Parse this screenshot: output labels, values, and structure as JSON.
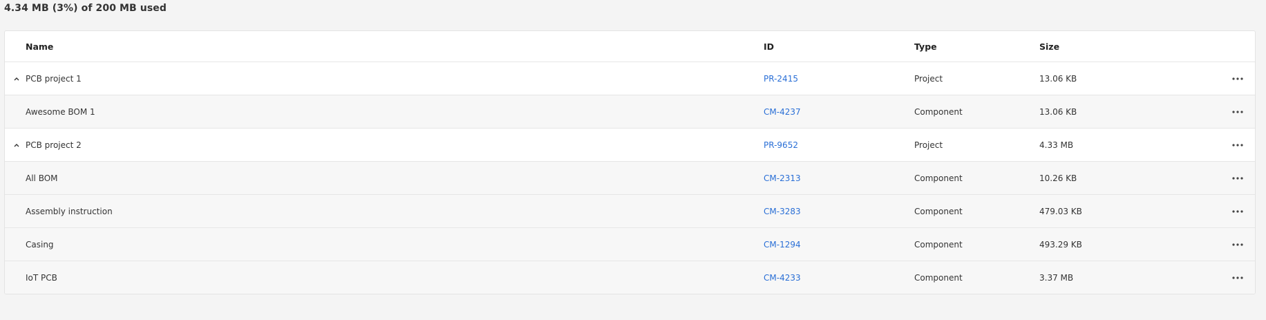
{
  "storage": {
    "usage_text": "4.34 MB (3%) of 200 MB used"
  },
  "table": {
    "columns": {
      "name": "Name",
      "id": "ID",
      "type": "Type",
      "size": "Size"
    },
    "rows": [
      {
        "kind": "parent",
        "name": "PCB project 1",
        "id": "PR-2415",
        "type": "Project",
        "size": "13.06 KB",
        "expanded": true
      },
      {
        "kind": "child",
        "name": "Awesome BOM 1",
        "id": "CM-4237",
        "type": "Component",
        "size": "13.06 KB"
      },
      {
        "kind": "parent",
        "name": "PCB project 2",
        "id": "PR-9652",
        "type": "Project",
        "size": "4.33 MB",
        "expanded": true
      },
      {
        "kind": "child",
        "name": "All BOM",
        "id": "CM-2313",
        "type": "Component",
        "size": "10.26 KB"
      },
      {
        "kind": "child",
        "name": "Assembly instruction",
        "id": "CM-3283",
        "type": "Component",
        "size": "479.03 KB"
      },
      {
        "kind": "child",
        "name": "Casing",
        "id": "CM-1294",
        "type": "Component",
        "size": "493.29 KB"
      },
      {
        "kind": "child",
        "name": "IoT PCB",
        "id": "CM-4233",
        "type": "Component",
        "size": "3.37 MB"
      }
    ]
  },
  "icons": {
    "expand": "chevron-up-icon",
    "more": "more-horizontal-icon"
  },
  "colors": {
    "link": "#2a6fd6",
    "background": "#f4f4f4",
    "child_row": "#f7f7f7"
  }
}
